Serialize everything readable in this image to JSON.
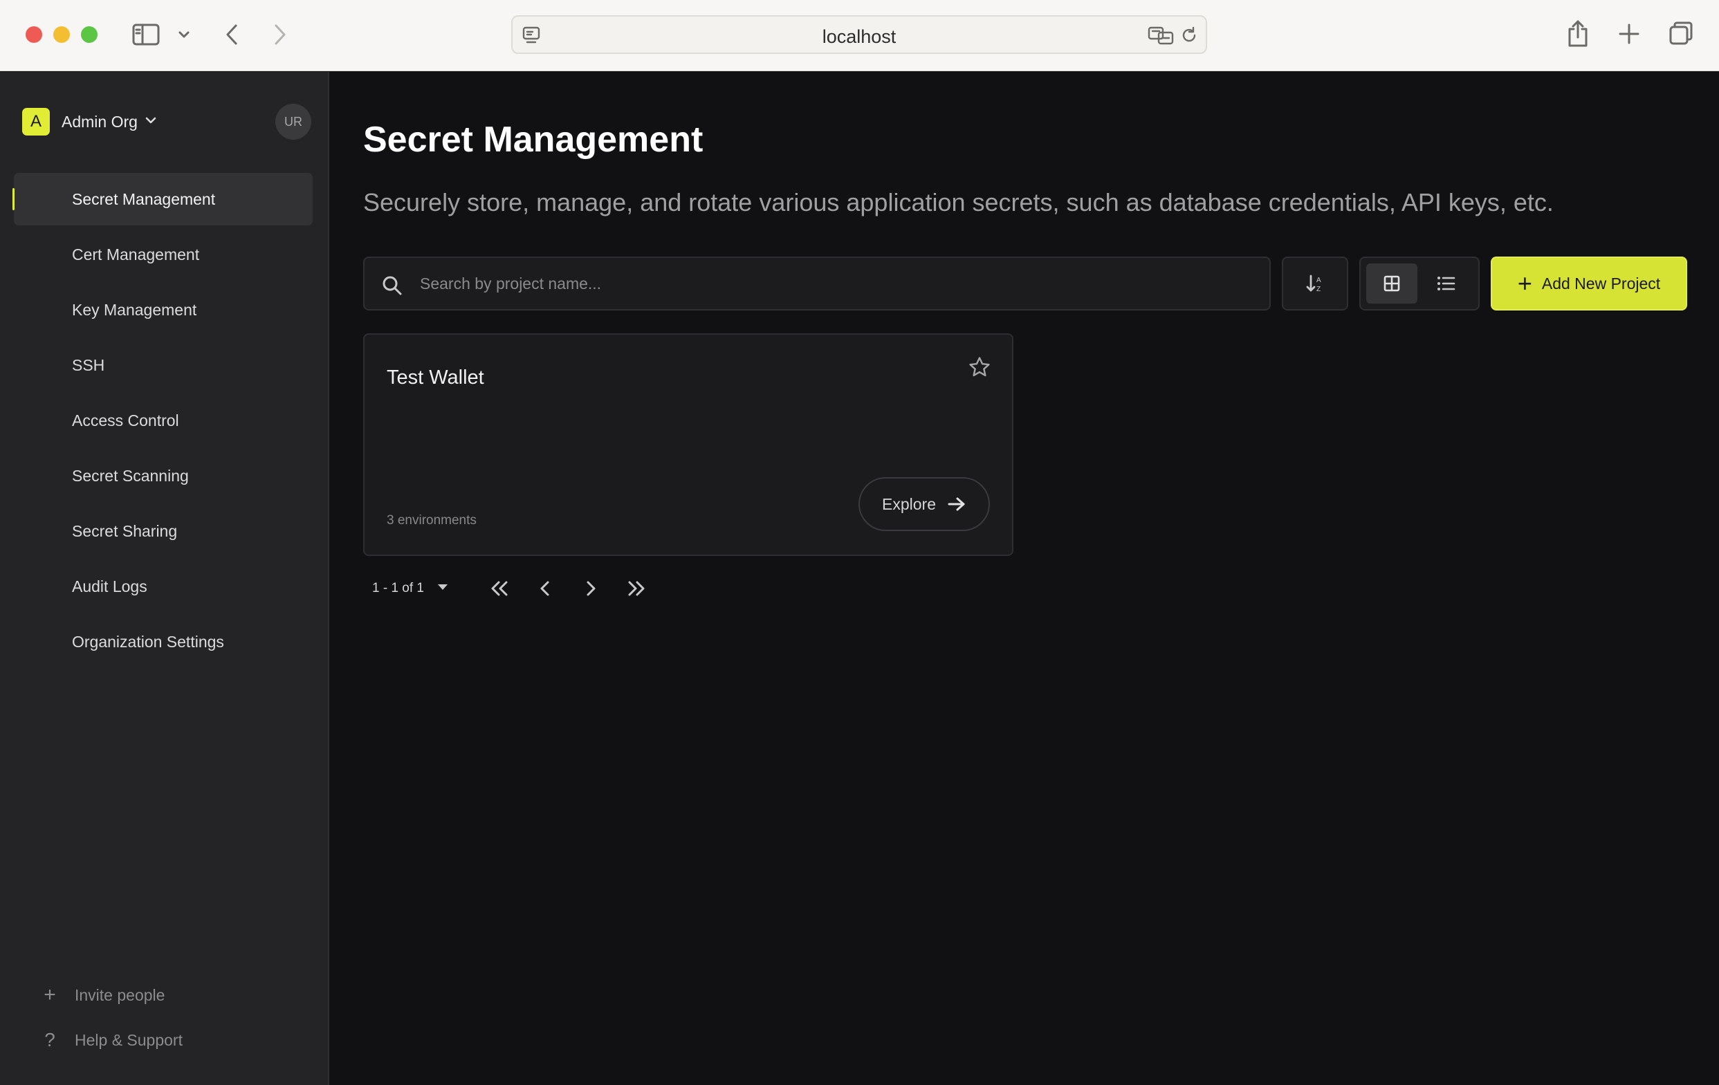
{
  "browser": {
    "url": "localhost"
  },
  "sidebar": {
    "org_initial": "A",
    "org_name": "Admin Org",
    "user_initials": "UR",
    "items": [
      {
        "label": "Secret Management",
        "active": true
      },
      {
        "label": "Cert Management"
      },
      {
        "label": "Key Management"
      },
      {
        "label": "SSH"
      },
      {
        "label": "Access Control"
      },
      {
        "label": "Secret Scanning"
      },
      {
        "label": "Secret Sharing"
      },
      {
        "label": "Audit Logs"
      },
      {
        "label": "Organization Settings"
      }
    ],
    "invite_label": "Invite people",
    "help_label": "Help & Support"
  },
  "main": {
    "title": "Secret Management",
    "subtitle": "Securely store, manage, and rotate various application secrets, such as database credentials, API keys, etc.",
    "search_placeholder": "Search by project name...",
    "add_button_label": "Add New Project",
    "projects": [
      {
        "name": "Test Wallet",
        "environments": "3 environments",
        "explore_label": "Explore"
      }
    ],
    "pagination": {
      "range": "1 - 1 of 1"
    }
  },
  "colors": {
    "accent": "#d6e234",
    "background": "#111113",
    "sidebar": "#242426"
  }
}
